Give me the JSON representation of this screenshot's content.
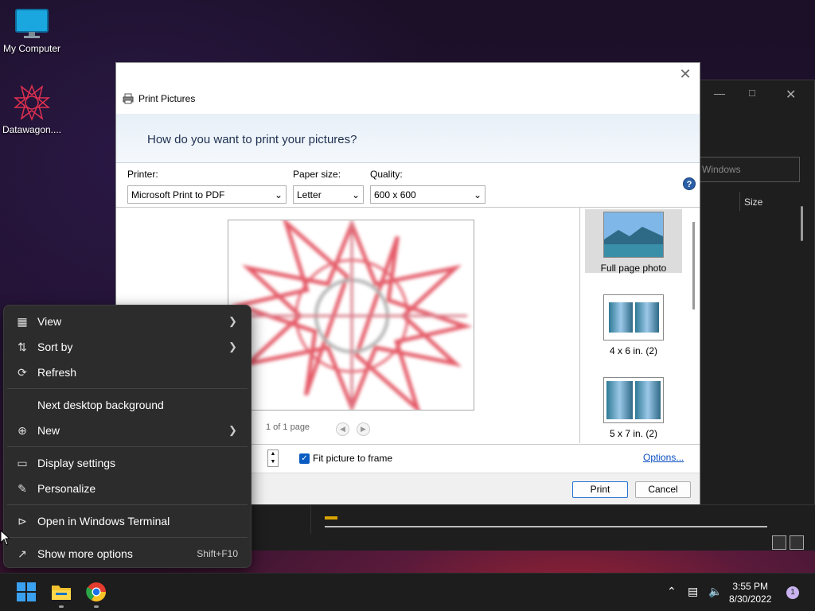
{
  "desktop": {
    "icons": [
      {
        "label": "My Computer"
      },
      {
        "label": "Datawagon...."
      }
    ]
  },
  "bg_window": {
    "search_placeholder": "Windows",
    "col_size": "Size"
  },
  "dialog": {
    "title": "Print Pictures",
    "question": "How do you want to print your pictures?",
    "printer_label": "Printer:",
    "printer_value": "Microsoft Print to PDF",
    "paper_label": "Paper size:",
    "paper_value": "Letter",
    "quality_label": "Quality:",
    "quality_value": "600 x 600",
    "help": "?",
    "pager": "1 of 1 page",
    "layouts": [
      {
        "label": "Full page photo"
      },
      {
        "label": "4 x 6 in. (2)"
      },
      {
        "label": "5 x 7 in. (2)"
      }
    ],
    "fit_label": "Fit picture to frame",
    "options_link": "Options...",
    "print_button": "Print",
    "cancel_button": "Cancel"
  },
  "context_menu": {
    "items": [
      {
        "label": "View",
        "icon": "view-grid-icon"
      },
      {
        "label": "Sort by",
        "icon": "sort-icon"
      },
      {
        "label": "Refresh",
        "icon": "refresh-icon"
      },
      {
        "label": "Next desktop background"
      },
      {
        "label": "New",
        "icon": "plus-circle-icon"
      },
      {
        "label": "Display settings",
        "icon": "display-icon"
      },
      {
        "label": "Personalize",
        "icon": "pen-icon"
      },
      {
        "label": "Open in Windows Terminal",
        "icon": "terminal-icon"
      },
      {
        "label": "Show more options",
        "icon": "share-icon",
        "shortcut": "Shift+F10"
      }
    ]
  },
  "taskbar": {
    "time": "3:55 PM",
    "date": "8/30/2022",
    "notifications": "1"
  }
}
